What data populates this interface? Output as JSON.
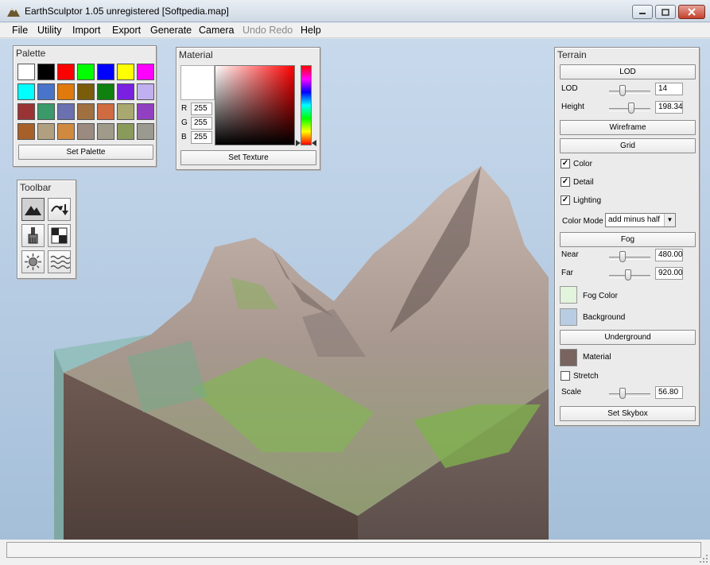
{
  "window": {
    "title": "EarthSculptor 1.05 unregistered [Softpedia.map]"
  },
  "menu": [
    {
      "label": "File",
      "enabled": true
    },
    {
      "label": "Utility",
      "enabled": true
    },
    {
      "label": "Import",
      "enabled": true
    },
    {
      "label": "Export",
      "enabled": true
    },
    {
      "label": "Generate",
      "enabled": true
    },
    {
      "label": "Camera",
      "enabled": true
    },
    {
      "label": "Undo Redo",
      "enabled": false
    },
    {
      "label": "Help",
      "enabled": true
    }
  ],
  "palette": {
    "title": "Palette",
    "swatch_colors": [
      "#ffffff",
      "#000000",
      "#ff0000",
      "#00ff00",
      "#0000ff",
      "#ffff00",
      "#ff00ff",
      "#00ffff",
      "#4a74c9",
      "#e07a0c",
      "#7a5c0a",
      "#10800e",
      "#7a20e0",
      "#c0b0f0",
      "#9a3434",
      "#3a9a6a",
      "#6a70b0",
      "#a07040",
      "#d06a40",
      "#a8a870",
      "#9040c0",
      "#a8602a",
      "#b0a080",
      "#d08a40",
      "#9a8a80",
      "#a09a8a",
      "#8a9a5a",
      "#9a9a90"
    ],
    "selected_index": 0,
    "set_button": "Set Palette"
  },
  "material": {
    "title": "Material",
    "rgb_labels": [
      "R",
      "G",
      "B"
    ],
    "rgb_values": [
      "255",
      "255",
      "255"
    ],
    "set_button": "Set Texture"
  },
  "toolbar": {
    "title": "Toolbar",
    "tools": [
      "mountain-icon",
      "raise-lower-icon",
      "paint-brush-icon",
      "checker-icon",
      "sun-icon",
      "waves-icon"
    ],
    "active_index": 0
  },
  "terrain": {
    "title": "Terrain",
    "lod_header": "LOD",
    "lod_label": "LOD",
    "lod_value": "14",
    "lod_slider": 0.3,
    "height_label": "Height",
    "height_value": "198.34",
    "height_slider": 0.55,
    "wireframe_button": "Wireframe",
    "grid_button": "Grid",
    "checks": [
      {
        "label": "Color",
        "checked": true
      },
      {
        "label": "Detail",
        "checked": true
      },
      {
        "label": "Lighting",
        "checked": true
      }
    ],
    "color_mode_label": "Color Mode",
    "color_mode_value": "add minus half",
    "fog_header": "Fog",
    "near_label": "Near",
    "near_value": "480.00",
    "near_slider": 0.3,
    "far_label": "Far",
    "far_value": "920.00",
    "far_slider": 0.45,
    "fog_color_label": "Fog Color",
    "fog_color": "#e2f4dc",
    "background_label": "Background",
    "background_color": "#b8cde2",
    "underground_header": "Underground",
    "material_label": "Material",
    "stretch_label": "Stretch",
    "stretch_checked": false,
    "scale_label": "Scale",
    "scale_value": "56.80",
    "scale_slider": 0.3,
    "skybox_button": "Set Skybox"
  }
}
